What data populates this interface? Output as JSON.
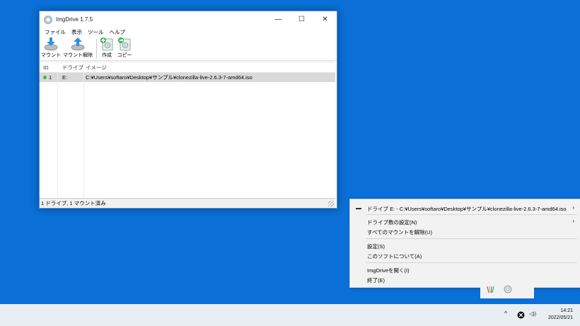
{
  "window": {
    "title": "ImgDrive 1.7.5",
    "controls": {
      "minimize": "—",
      "maximize": "☐",
      "close": "✕"
    }
  },
  "menu": [
    "ファイル",
    "表示",
    "ツール",
    "ヘルプ"
  ],
  "toolbar": {
    "mount": "マウント",
    "unmount": "マウント解除",
    "create": "作成",
    "copy": "コピー"
  },
  "table": {
    "columns": [
      "ID",
      "ドライブ",
      "イメージ"
    ],
    "rows": [
      {
        "id": "1",
        "drive": "E:",
        "image": "C:¥Users¥softaro¥Desktop¥サンプル¥clonezilla-live-2.6.3-7-amd64.iso"
      }
    ]
  },
  "status": "1 ドライブ, 1 マウント済み",
  "context_menu": {
    "drive_item": "ドライブ E: - C:¥Users¥softaro¥Desktop¥サンプル¥clonezilla-live-2.6.3-7-amd64.iso",
    "drive_count": "ドライブ数の設定(N)",
    "unmount_all": "すべてのマウントを解除(U)",
    "settings": "設定(S)",
    "about": "このソフトについて(A)",
    "open": "ImgDriveを開く(I)",
    "exit": "終了(E)",
    "submenu_arrow": "›"
  },
  "taskbar": {
    "time": "14:21",
    "date": "2022/05/21",
    "up_arrow": "^",
    "volume": "◁))"
  }
}
